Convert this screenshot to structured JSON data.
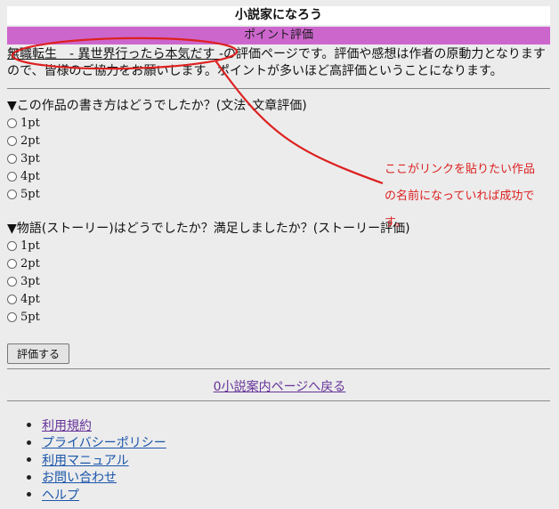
{
  "header": {
    "title": "小説家になろう",
    "subtitle": "ポイント評価"
  },
  "intro": {
    "link_text": "無職転生　- 異世界行ったら本気だす -",
    "text": "の評価ページです。評価や感想は作者の原動力となりますので、皆様のご協力をお願いします。ポイントが多いほど高評価ということになります。"
  },
  "questions": [
    {
      "label": "▼この作品の書き方はどうでしたか？(文法･文章評価)",
      "options": [
        "1pt",
        "2pt",
        "3pt",
        "4pt",
        "5pt"
      ]
    },
    {
      "label": "▼物語(ストーリー)はどうでしたか？満足しましたか？(ストーリー評価)",
      "options": [
        "1pt",
        "2pt",
        "3pt",
        "4pt",
        "5pt"
      ]
    }
  ],
  "submit_label": "評価する",
  "back_link": "0小説案内ページへ戻る",
  "footer_links": [
    "利用規約",
    "プライバシーポリシー",
    "利用マニュアル",
    "お問い合わせ",
    "ヘルプ"
  ],
  "annotation": {
    "lines": [
      "ここがリンクを貼りたい作品",
      "の名前になっていれば成功で",
      "す。"
    ]
  },
  "colors": {
    "accent_bar": "#cc66cc",
    "annotation_red": "#dd2020",
    "link_purple": "#663399"
  }
}
